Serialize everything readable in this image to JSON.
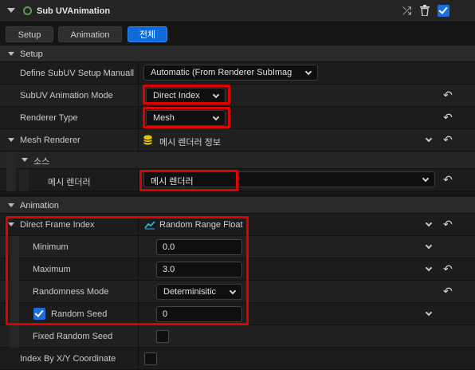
{
  "header": {
    "title": "Sub UVAnimation",
    "icons": [
      "shuffle-icon",
      "trash-icon",
      "enabled-checkbox"
    ]
  },
  "tabs": [
    {
      "label": "Setup"
    },
    {
      "label": "Animation"
    },
    {
      "label": "전체",
      "active": true
    }
  ],
  "sections": {
    "setup": "Setup",
    "mesh_renderer": "Mesh Renderer",
    "source": "소스",
    "animation": "Animation"
  },
  "rows": {
    "define_setup": {
      "label": "Define SubUV Setup Manuall",
      "value": "Automatic (From Renderer SubImag"
    },
    "anim_mode": {
      "label": "SubUV Animation Mode",
      "value": "Direct Index"
    },
    "renderer_type": {
      "label": "Renderer Type",
      "value": "Mesh"
    },
    "mesh_renderer": {
      "label": "Mesh Renderer",
      "value": "메시 렌더러 정보"
    },
    "mesh_renderer_ref": {
      "label": "메시 렌더러",
      "value": "메시 렌더러"
    },
    "direct_frame_index": {
      "label": "Direct Frame Index",
      "value": "Random Range Float"
    },
    "minimum": {
      "label": "Minimum",
      "value": "0.0"
    },
    "maximum": {
      "label": "Maximum",
      "value": "3.0"
    },
    "randomness_mode": {
      "label": "Randomness Mode",
      "value": "Determinisitic"
    },
    "random_seed": {
      "label": "Random Seed",
      "value": "0"
    },
    "fixed_random_seed": {
      "label": "Fixed Random Seed"
    },
    "index_by_xy": {
      "label": "Index By X/Y Coordinate"
    }
  },
  "colors": {
    "accent": "#0f6bd9",
    "highlight": "#e00000",
    "module_ring": "#5f9a59",
    "db_icon": "#e5c400",
    "curve_icon": "#2fb3d6"
  }
}
